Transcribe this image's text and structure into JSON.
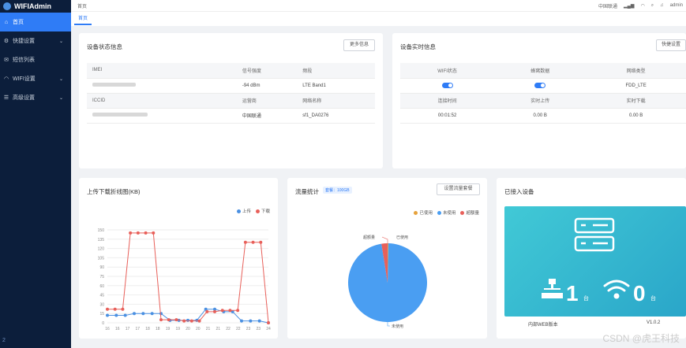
{
  "app": {
    "title": "WIFIAdmin",
    "version": "2"
  },
  "sidebar": {
    "items": [
      {
        "label": "首页",
        "icon": "home-icon",
        "active": true,
        "chevron": false
      },
      {
        "label": "快捷设置",
        "icon": "settings-icon",
        "active": false,
        "chevron": true
      },
      {
        "label": "短信列表",
        "icon": "message-icon",
        "active": false,
        "chevron": false
      },
      {
        "label": "WIFI设置",
        "icon": "wifi-icon",
        "active": false,
        "chevron": true
      },
      {
        "label": "高级设置",
        "icon": "advanced-icon",
        "active": false,
        "chevron": true
      }
    ]
  },
  "header": {
    "breadcrumb": "首页",
    "carrier": "中国联通",
    "user": "admin"
  },
  "tabs": [
    {
      "label": "首页"
    }
  ],
  "device_status": {
    "title": "设备状态信息",
    "more_button": "更多信息",
    "row1_headers": [
      "IMEI",
      "信号强度",
      "频段"
    ],
    "row1_values": [
      "",
      "-94 dBm",
      "LTE Band1"
    ],
    "row2_headers": [
      "ICCID",
      "运营商",
      "网络名称"
    ],
    "row2_values": [
      "",
      "中国联通",
      "sf1_DA0276"
    ]
  },
  "realtime": {
    "title": "设备实时信息",
    "button": "快捷设置",
    "headers1": [
      "WIFI状态",
      "蜂窝数据",
      "网络类型"
    ],
    "values1_type": "FDD_LTE",
    "headers2": [
      "连接时间",
      "实时上传",
      "实时下载"
    ],
    "values2": [
      "00:01:52",
      "0.00 B",
      "0.00 B"
    ]
  },
  "line_chart": {
    "title": "上传下载折线图(KB)"
  },
  "chart_data": [
    {
      "type": "line",
      "title": "上传下载折线图(KB)",
      "categories": [
        "16",
        "16",
        "17",
        "17",
        "18",
        "18",
        "19",
        "19",
        "20",
        "20",
        "21",
        "21",
        "22",
        "22",
        "23",
        "23",
        "24"
      ],
      "series": [
        {
          "name": "上传",
          "color": "#4a90e2",
          "values": [
            12,
            12,
            12,
            15,
            15,
            15,
            15,
            4,
            4,
            4,
            4,
            22,
            22,
            18,
            18,
            3,
            3,
            3,
            0
          ]
        },
        {
          "name": "下载",
          "color": "#e8605a",
          "values": [
            22,
            22,
            22,
            145,
            145,
            145,
            145,
            5,
            5,
            5,
            3,
            3,
            3,
            18,
            18,
            20,
            20,
            20,
            130,
            130,
            130,
            0
          ]
        }
      ],
      "yticks": [
        "0",
        "15",
        "30",
        "45",
        "60",
        "75",
        "90",
        "105",
        "120",
        "135",
        "150"
      ],
      "xticks": [
        "16",
        "16",
        "17",
        "17",
        "18",
        "18",
        "19",
        "19",
        "20",
        "20",
        "21",
        "21",
        "22",
        "22",
        "23",
        "23",
        "24"
      ],
      "ylim": [
        0,
        150
      ],
      "legend": "top-right"
    },
    {
      "type": "pie",
      "title": "流量统计",
      "slices": [
        {
          "name": "已使用",
          "value": 0.3,
          "color": "#e6a23c"
        },
        {
          "name": "未使用",
          "value": 97.2,
          "color": "#4a9ef2"
        },
        {
          "name": "超额量",
          "value": 2.5,
          "color": "#e8605a"
        }
      ]
    }
  ],
  "traffic": {
    "title": "流量统计",
    "badge": "套餐：100GB",
    "button": "设置流量套餐",
    "legend": [
      "已使用",
      "未使用",
      "超额量"
    ],
    "labels": [
      "超额量",
      "已使用",
      "未使用"
    ]
  },
  "devices": {
    "title": "已接入设备",
    "wired_count": "1",
    "wired_unit": "台",
    "wifi_count": "0",
    "wifi_unit": "台",
    "firmware_label": "内部WEB版本",
    "firmware_value": "V1.0.2"
  },
  "watermark": "CSDN @虎王科技"
}
